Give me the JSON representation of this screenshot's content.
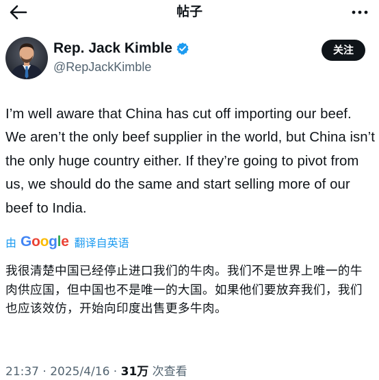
{
  "header": {
    "title": "帖子",
    "back_icon": "arrow-left-icon",
    "more_icon": "more-vertical-icon"
  },
  "author": {
    "display_name": "Rep. Jack Kimble",
    "handle": "@RepJackKimble",
    "verified": true,
    "verified_icon": "verified-badge-icon",
    "follow_label": "关注"
  },
  "tweet": {
    "text": "I’m well aware that China has cut off importing our beef. We aren’t the only beef supplier in the world, but China isn’t the only huge country either. If they’re going to pivot from us, we should do the same and start selling more of our beef to India."
  },
  "translation": {
    "by_label": "由",
    "provider": "Google",
    "link_label": "翻译自英语",
    "text": "我很清楚中国已经停止进口我们的牛肉。我们不是世界上唯一的牛肉供应国，但中国也不是唯一的大国。如果他们要放弃我们，我们也应该效仿，开始向印度出售更多牛肉。"
  },
  "meta": {
    "time": "21:37",
    "separator1": " · ",
    "date": "2025/4/16",
    "separator2": " · ",
    "views_count": "31万",
    "views_label": " 次查看"
  },
  "colors": {
    "text_primary": "#0f1419",
    "text_secondary": "#536471",
    "accent": "#1d9bf0",
    "follow_button_bg": "#0f1419",
    "verified": "#1d9bf0",
    "google_blue": "#4285f4",
    "google_red": "#ea4335",
    "google_yellow": "#fbbc05",
    "google_green": "#34a853"
  }
}
